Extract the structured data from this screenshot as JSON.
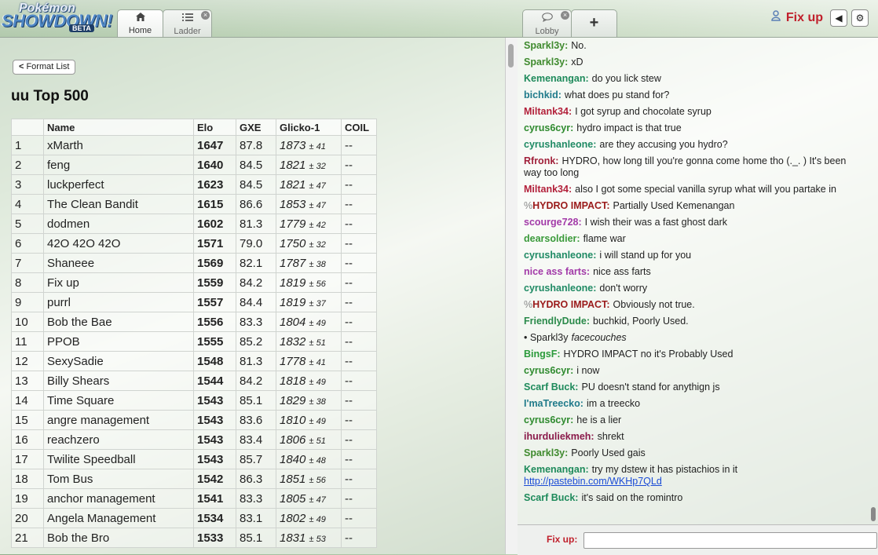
{
  "header": {
    "logo": {
      "line1": "Pokémon",
      "line2": "SHOWDOWN!",
      "badge": "BETA"
    },
    "tabs": [
      {
        "label": "Home",
        "icon": "home-icon"
      },
      {
        "label": "Ladder",
        "icon": "list-icon"
      },
      {
        "label": "Lobby",
        "icon": "chat-bubble-icon"
      },
      {
        "label": "+",
        "icon": "plus-icon"
      }
    ],
    "close_glyph": "×",
    "username": "Fix up",
    "sound_glyph": "◀",
    "options_glyph": "⚙"
  },
  "ladder": {
    "back_button": "Format List",
    "title": "uu Top 500",
    "columns": [
      "",
      "Name",
      "Elo",
      "GXE",
      "Glicko-1",
      "COIL"
    ],
    "rows": [
      {
        "rank": "1",
        "name": "xMarth",
        "elo": "1647",
        "gxe": "87.8",
        "glicko": "1873",
        "dev": "± 41",
        "coil": "--"
      },
      {
        "rank": "2",
        "name": "feng",
        "elo": "1640",
        "gxe": "84.5",
        "glicko": "1821",
        "dev": "± 32",
        "coil": "--"
      },
      {
        "rank": "3",
        "name": "luckperfect",
        "elo": "1623",
        "gxe": "84.5",
        "glicko": "1821",
        "dev": "± 47",
        "coil": "--"
      },
      {
        "rank": "4",
        "name": "The Clean Bandit",
        "elo": "1615",
        "gxe": "86.6",
        "glicko": "1853",
        "dev": "± 47",
        "coil": "--"
      },
      {
        "rank": "5",
        "name": "dodmen",
        "elo": "1602",
        "gxe": "81.3",
        "glicko": "1779",
        "dev": "± 42",
        "coil": "--"
      },
      {
        "rank": "6",
        "name": "42O 42O 42O",
        "elo": "1571",
        "gxe": "79.0",
        "glicko": "1750",
        "dev": "± 32",
        "coil": "--"
      },
      {
        "rank": "7",
        "name": "Shaneee",
        "elo": "1569",
        "gxe": "82.1",
        "glicko": "1787",
        "dev": "± 38",
        "coil": "--"
      },
      {
        "rank": "8",
        "name": "Fix up",
        "elo": "1559",
        "gxe": "84.2",
        "glicko": "1819",
        "dev": "± 56",
        "coil": "--"
      },
      {
        "rank": "9",
        "name": "purrl",
        "elo": "1557",
        "gxe": "84.4",
        "glicko": "1819",
        "dev": "± 37",
        "coil": "--"
      },
      {
        "rank": "10",
        "name": "Bob the Bae",
        "elo": "1556",
        "gxe": "83.3",
        "glicko": "1804",
        "dev": "± 49",
        "coil": "--"
      },
      {
        "rank": "11",
        "name": "PPOB",
        "elo": "1555",
        "gxe": "85.2",
        "glicko": "1832",
        "dev": "± 51",
        "coil": "--"
      },
      {
        "rank": "12",
        "name": "SexySadie",
        "elo": "1548",
        "gxe": "81.3",
        "glicko": "1778",
        "dev": "± 41",
        "coil": "--"
      },
      {
        "rank": "13",
        "name": "Billy Shears",
        "elo": "1544",
        "gxe": "84.2",
        "glicko": "1818",
        "dev": "± 49",
        "coil": "--"
      },
      {
        "rank": "14",
        "name": "Time Square",
        "elo": "1543",
        "gxe": "85.1",
        "glicko": "1829",
        "dev": "± 38",
        "coil": "--"
      },
      {
        "rank": "15",
        "name": "angre management",
        "elo": "1543",
        "gxe": "83.6",
        "glicko": "1810",
        "dev": "± 49",
        "coil": "--"
      },
      {
        "rank": "16",
        "name": "reachzero",
        "elo": "1543",
        "gxe": "83.4",
        "glicko": "1806",
        "dev": "± 51",
        "coil": "--"
      },
      {
        "rank": "17",
        "name": "Twilite Speedball",
        "elo": "1543",
        "gxe": "85.7",
        "glicko": "1840",
        "dev": "± 48",
        "coil": "--"
      },
      {
        "rank": "18",
        "name": "Tom Bus",
        "elo": "1542",
        "gxe": "86.3",
        "glicko": "1851",
        "dev": "± 56",
        "coil": "--"
      },
      {
        "rank": "19",
        "name": "anchor management",
        "elo": "1541",
        "gxe": "83.3",
        "glicko": "1805",
        "dev": "± 47",
        "coil": "--"
      },
      {
        "rank": "20",
        "name": "Angela Management",
        "elo": "1534",
        "gxe": "83.1",
        "glicko": "1802",
        "dev": "± 49",
        "coil": "--"
      },
      {
        "rank": "21",
        "name": "Bob the Bro",
        "elo": "1533",
        "gxe": "85.1",
        "glicko": "1831",
        "dev": "± 53",
        "coil": "--"
      }
    ]
  },
  "chat": {
    "messages": [
      {
        "user": "Sparkl3y:",
        "color": "#3f8a2e",
        "text": "No."
      },
      {
        "user": "Sparkl3y:",
        "color": "#3f8a2e",
        "text": "xD"
      },
      {
        "user": "Kemenangan:",
        "color": "#1e8a5b",
        "text": "do you lick stew"
      },
      {
        "user": "bichkid:",
        "color": "#1f7a8a",
        "text": "what does pu stand for?"
      },
      {
        "user": "Miltank34:",
        "color": "#b2203a",
        "text": "I got syrup and chocolate syrup"
      },
      {
        "user": "cyrus6cyr:",
        "color": "#2e8a2e",
        "text": "hydro impact is that true"
      },
      {
        "user": "cyrushanleone:",
        "color": "#1f8a64",
        "text": "are they accusing you hydro?"
      },
      {
        "user": "Rfronk:",
        "color": "#a0203a",
        "text": "HYDRO, how long till you're gonna come home tho (._. ) It's been way too long"
      },
      {
        "user": "Miltank34:",
        "color": "#b2203a",
        "text": "also I got some special vanilla syrup what will you partake in"
      },
      {
        "group": "%",
        "user": "HYDRO IMPACT:",
        "color": "#9a1a1a",
        "text": "Partially Used Kemenangan"
      },
      {
        "user": "scourge728:",
        "color": "#a23aa8",
        "text": "I wish their was a fast ghost dark"
      },
      {
        "user": "dearsoldier:",
        "color": "#3a9a3a",
        "text": "flame war"
      },
      {
        "user": "cyrushanleone:",
        "color": "#1f8a64",
        "text": "i will stand up for you"
      },
      {
        "user": "nice ass farts:",
        "color": "#a23aa8",
        "text": "nice ass farts"
      },
      {
        "user": "cyrushanleone:",
        "color": "#1f8a64",
        "text": "don't worry"
      },
      {
        "group": "%",
        "user": "HYDRO IMPACT:",
        "color": "#9a1a1a",
        "text": "Obviously not true."
      },
      {
        "user": "FriendlyDude:",
        "color": "#2a8a4a",
        "text": "buchkid, Poorly Used."
      },
      {
        "emote": true,
        "user": "• Sparkl3y",
        "text": "facecouches"
      },
      {
        "user": "BingsF:",
        "color": "#2a9a3a",
        "text": "HYDRO IMPACT no it's Probably Used"
      },
      {
        "user": "cyrus6cyr:",
        "color": "#2e8a2e",
        "text": "i now"
      },
      {
        "user": "Scarf Buck:",
        "color": "#1e8a5b",
        "text": "PU doesn't stand for anythign js"
      },
      {
        "user": "I'maTreecko:",
        "color": "#1f7a8a",
        "text": "im a treecko"
      },
      {
        "user": "cyrus6cyr:",
        "color": "#2e8a2e",
        "text": "he is a lier"
      },
      {
        "user": "ihurduliekmeh:",
        "color": "#8a1a4a",
        "text": "shrekt"
      },
      {
        "user": "Sparkl3y:",
        "color": "#3f8a2e",
        "text": "Poorly Used gais"
      },
      {
        "user": "Kemenangan:",
        "color": "#1e8a5b",
        "text": "try my dstew it has pistachios in it",
        "link": "http://pastebin.com/WKHp7QLd"
      },
      {
        "user": "Scarf Buck:",
        "color": "#1e8a5b",
        "text": "it's said on the romintro"
      }
    ],
    "input_label": "Fix up:",
    "input_value": ""
  }
}
